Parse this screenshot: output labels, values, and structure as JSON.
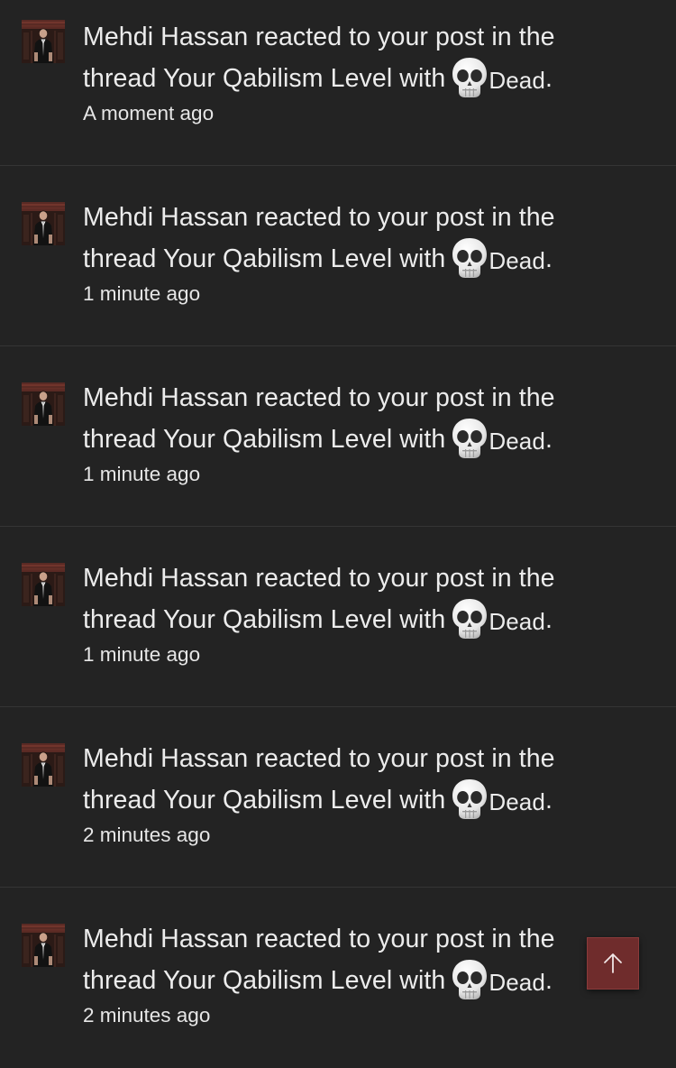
{
  "notifications": [
    {
      "user": "Mehdi Hassan",
      "action": "reacted to your post in the thread",
      "thread": "Your Qabilism Level",
      "with": "with",
      "reaction": "Dead",
      "end": ".",
      "time": "A moment ago",
      "avatar_icon": "user-avatar"
    },
    {
      "user": "Mehdi Hassan",
      "action": "reacted to your post in the thread",
      "thread": "Your Qabilism Level",
      "with": "with",
      "reaction": "Dead",
      "end": ".",
      "time": "1 minute ago",
      "avatar_icon": "user-avatar"
    },
    {
      "user": "Mehdi Hassan",
      "action": "reacted to your post in the thread",
      "thread": "Your Qabilism Level",
      "with": "with",
      "reaction": "Dead",
      "end": ".",
      "time": "1 minute ago",
      "avatar_icon": "user-avatar"
    },
    {
      "user": "Mehdi Hassan",
      "action": "reacted to your post in the thread",
      "thread": "Your Qabilism Level",
      "with": "with",
      "reaction": "Dead",
      "end": ".",
      "time": "1 minute ago",
      "avatar_icon": "user-avatar"
    },
    {
      "user": "Mehdi Hassan",
      "action": "reacted to your post in the thread",
      "thread": "Your Qabilism Level",
      "with": "with",
      "reaction": "Dead",
      "end": ".",
      "time": "2 minutes ago",
      "avatar_icon": "user-avatar"
    },
    {
      "user": "Mehdi Hassan",
      "action": "reacted to your post in the thread",
      "thread": "Your Qabilism Level",
      "with": "with",
      "reaction": "Dead",
      "end": ".",
      "time": "2 minutes ago",
      "avatar_icon": "user-avatar"
    }
  ],
  "reaction_icon": "skull-icon",
  "scroll_top_icon": "arrow-up-icon",
  "colors": {
    "background": "#232323",
    "divider": "#353535",
    "text": "#ececec",
    "scroll_top_bg": "#6f2c2c"
  }
}
